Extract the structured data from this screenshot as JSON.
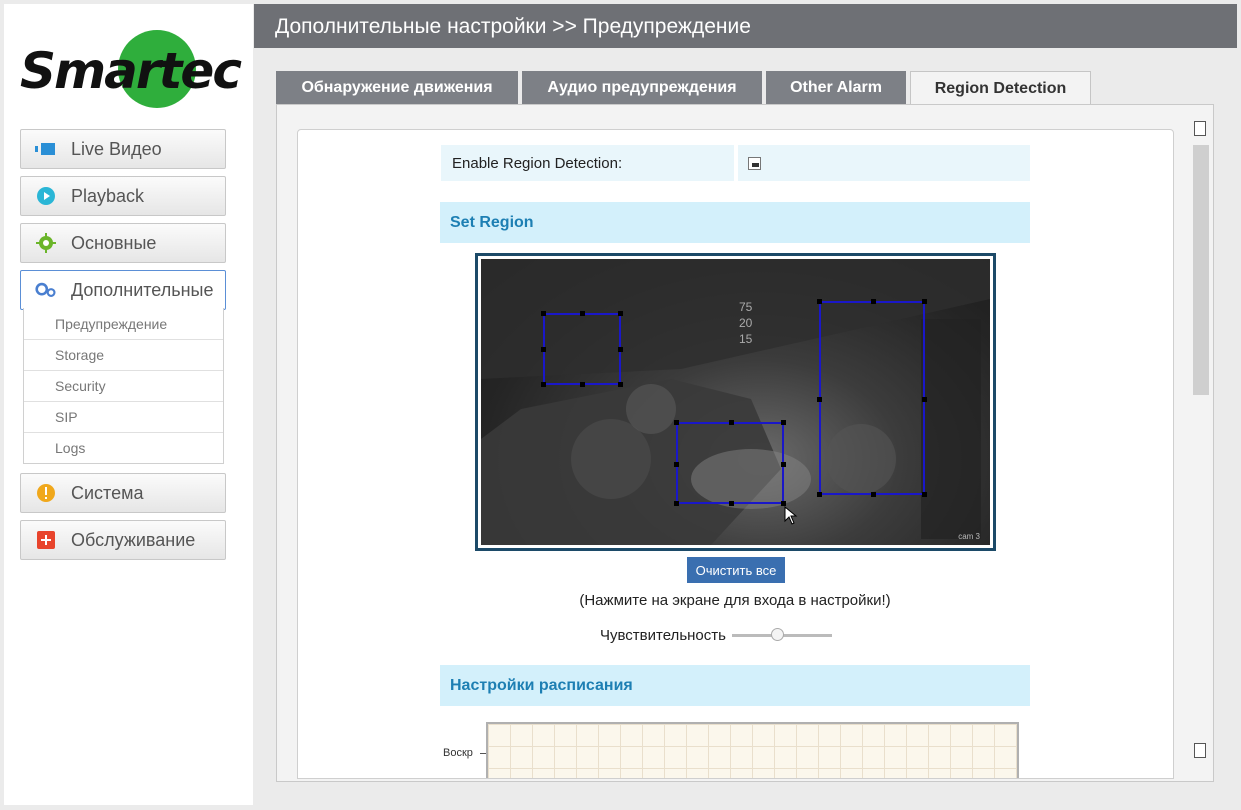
{
  "brand": {
    "logo_text": "Smartec"
  },
  "sidebar": {
    "items": [
      {
        "label": "Live Видео",
        "icon": "video-icon"
      },
      {
        "label": "Playback",
        "icon": "play-icon"
      },
      {
        "label": "Основные",
        "icon": "gear-icon"
      },
      {
        "label": "Дополнительные",
        "icon": "gears-icon"
      },
      {
        "label": "Система",
        "icon": "warning-icon"
      },
      {
        "label": "Обслуживание",
        "icon": "plus-icon"
      }
    ],
    "submenu": [
      "Предупреждение",
      "Storage",
      "Security",
      "SIP",
      "Logs"
    ]
  },
  "header": {
    "title": "Дополнительные настройки >> Предупреждение"
  },
  "tabs": [
    {
      "label": "Обнаружение движения"
    },
    {
      "label": "Аудио предупреждения"
    },
    {
      "label": "Other Alarm"
    },
    {
      "label": "Region Detection",
      "active": true
    }
  ],
  "region": {
    "enable_label": "Enable Region Detection:",
    "enabled": true,
    "set_region_title": "Set Region",
    "camera_label": "cam 3",
    "overlay_text": "75 20 15",
    "clear_button": "Очистить все",
    "hint": "(Нажмите на экране для входа в настройки!)",
    "sensitivity_label": "Чувствительность",
    "sensitivity_value": 0.45
  },
  "schedule": {
    "title": "Настройки расписания",
    "first_day": "Воскр"
  },
  "colors": {
    "accent": "#1d7fb3",
    "header_bg": "#6e7075",
    "region_border": "#1a17c9"
  }
}
